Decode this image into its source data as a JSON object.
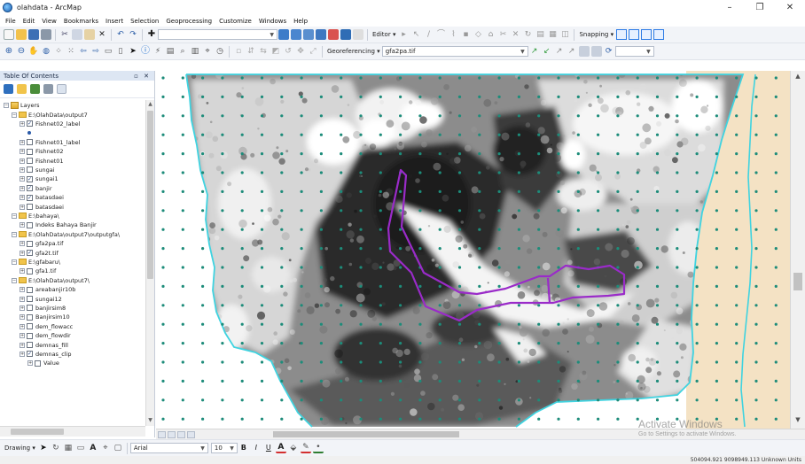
{
  "window": {
    "title": "olahdata - ArcMap",
    "controls": {
      "minimize": "–",
      "maximize": "❐",
      "close": "✕"
    }
  },
  "menu": [
    "File",
    "Edit",
    "View",
    "Bookmarks",
    "Insert",
    "Selection",
    "Geoprocessing",
    "Customize",
    "Windows",
    "Help"
  ],
  "toolbar": {
    "editor_label": "Editor ▾",
    "snapping_label": "Snapping ▾",
    "georef_label": "Georeferencing ▾",
    "georef_layer": "gfa2pa.tif"
  },
  "toc": {
    "title": "Table Of Contents",
    "header_controls": "▫ ✕",
    "items": [
      {
        "type": "root",
        "label": "Layers",
        "level": 0
      },
      {
        "type": "group",
        "label": "E:\\OlahData\\output7",
        "level": 1
      },
      {
        "type": "layer",
        "label": "Fishnet02_label",
        "checked": true,
        "level": 2
      },
      {
        "type": "symbol",
        "label": "",
        "level": 3
      },
      {
        "type": "layer",
        "label": "Fishnet01_label",
        "checked": false,
        "level": 2
      },
      {
        "type": "layer",
        "label": "Fishnet02",
        "checked": false,
        "level": 2
      },
      {
        "type": "layer",
        "label": "Fishnet01",
        "checked": false,
        "level": 2
      },
      {
        "type": "layer",
        "label": "sungai",
        "checked": false,
        "level": 2
      },
      {
        "type": "layer",
        "label": "sungai1",
        "checked": true,
        "level": 2
      },
      {
        "type": "layer",
        "label": "banjir",
        "checked": true,
        "level": 2
      },
      {
        "type": "layer",
        "label": "batasdaei",
        "checked": true,
        "level": 2
      },
      {
        "type": "layer",
        "label": "batasdaei",
        "checked": false,
        "level": 2
      },
      {
        "type": "group",
        "label": "E:\\bahaya\\",
        "level": 1
      },
      {
        "type": "layer",
        "label": "Indeks Bahaya Banjir",
        "checked": false,
        "level": 2
      },
      {
        "type": "group",
        "label": "E:\\OlahData\\output7\\outputgfa\\",
        "level": 1
      },
      {
        "type": "layer",
        "label": "gfa2pa.tif",
        "checked": false,
        "level": 2
      },
      {
        "type": "layer",
        "label": "gfa2t.tif",
        "checked": true,
        "level": 2
      },
      {
        "type": "group",
        "label": "E:\\gfabaru\\",
        "level": 1
      },
      {
        "type": "layer",
        "label": "gfa1.tif",
        "checked": false,
        "level": 2
      },
      {
        "type": "group",
        "label": "E:\\OlahData\\output7\\",
        "level": 1
      },
      {
        "type": "layer",
        "label": "areabanjir10b",
        "checked": false,
        "level": 2
      },
      {
        "type": "layer",
        "label": "sungai12",
        "checked": false,
        "level": 2
      },
      {
        "type": "layer",
        "label": "banjirsim8",
        "checked": false,
        "level": 2
      },
      {
        "type": "layer",
        "label": "Banjirsim10",
        "checked": false,
        "level": 2
      },
      {
        "type": "layer",
        "label": "dem_flowacc",
        "checked": false,
        "level": 2
      },
      {
        "type": "layer",
        "label": "dem_flowdir",
        "checked": false,
        "level": 2
      },
      {
        "type": "layer",
        "label": "demnas_fill",
        "checked": false,
        "level": 2
      },
      {
        "type": "layer",
        "label": "demnas_clip",
        "checked": true,
        "level": 2
      },
      {
        "type": "layer",
        "label": "Value",
        "checked": false,
        "level": 3
      }
    ]
  },
  "drawing": {
    "drawing_label": "Drawing ▾",
    "font": "Arial",
    "font_size": "10",
    "bold": "B",
    "italic": "I",
    "underline": "U",
    "font_color": "A"
  },
  "status": {
    "coordinates": "504094.921  9098949.113 Unknown Units"
  },
  "watermark": {
    "line1": "Activate Windows",
    "line2": "Go to Settings to activate Windows."
  },
  "colors": {
    "boundary": "#3fd3e0",
    "flood_polygon": "#9a2bc9",
    "fishnet_point": "#1d8c7a",
    "land_fill": "#f4e2c4"
  },
  "icons": [
    "new-document-icon",
    "open-icon",
    "save-icon",
    "print-icon",
    "cut-icon",
    "copy-icon",
    "paste-icon",
    "delete-icon",
    "undo-icon",
    "redo-icon",
    "add-data-icon",
    "zoom-in-icon",
    "zoom-out-icon",
    "pan-icon",
    "full-extent-icon",
    "identify-icon",
    "select-icon",
    "measure-icon",
    "find-icon"
  ]
}
